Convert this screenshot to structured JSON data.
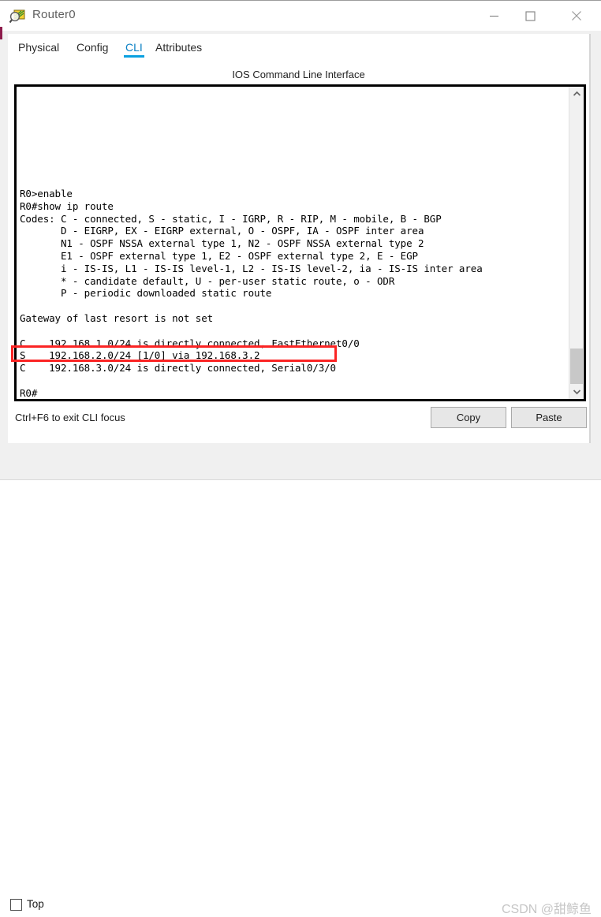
{
  "window": {
    "title": "Router0",
    "icon": "router-magnifier-icon",
    "controls": {
      "minimize": "minimize-icon",
      "maximize": "maximize-icon",
      "close": "close-icon"
    }
  },
  "tabs": [
    {
      "label": "Physical",
      "active": false
    },
    {
      "label": "Config",
      "active": false
    },
    {
      "label": "CLI",
      "active": true
    },
    {
      "label": "Attributes",
      "active": false
    }
  ],
  "cli": {
    "header": "IOS Command Line Interface",
    "terminal_text": "R0>enable\nR0#show ip route\nCodes: C - connected, S - static, I - IGRP, R - RIP, M - mobile, B - BGP\n       D - EIGRP, EX - EIGRP external, O - OSPF, IA - OSPF inter area\n       N1 - OSPF NSSA external type 1, N2 - OSPF NSSA external type 2\n       E1 - OSPF external type 1, E2 - OSPF external type 2, E - EGP\n       i - IS-IS, L1 - IS-IS level-1, L2 - IS-IS level-2, ia - IS-IS inter area\n       * - candidate default, U - per-user static route, o - ODR\n       P - periodic downloaded static route\n\nGateway of last resort is not set\n\nC    192.168.1.0/24 is directly connected, FastEthernet0/0\nS    192.168.2.0/24 [1/0] via 192.168.3.2\nC    192.168.3.0/24 is directly connected, Serial0/3/0\n\nR0#",
    "highlighted_route": "S    192.168.2.0/24 [1/0] via 192.168.3.2",
    "highlight_color": "#fb2424",
    "hint": "Ctrl+F6 to exit CLI focus"
  },
  "scrollbar": {
    "up_arrow": "chevron-up-icon",
    "down_arrow": "chevron-down-icon"
  },
  "actions": {
    "copy_label": "Copy",
    "paste_label": "Paste"
  },
  "footer": {
    "top_label": "Top",
    "top_checked": false,
    "watermark": "CSDN @甜鲸鱼"
  },
  "colors": {
    "accent_blue": "#09a0e0",
    "tab_active_text": "#0b80c4",
    "highlight_red": "#fb2424",
    "panel_bg": "#f0f0f0"
  }
}
